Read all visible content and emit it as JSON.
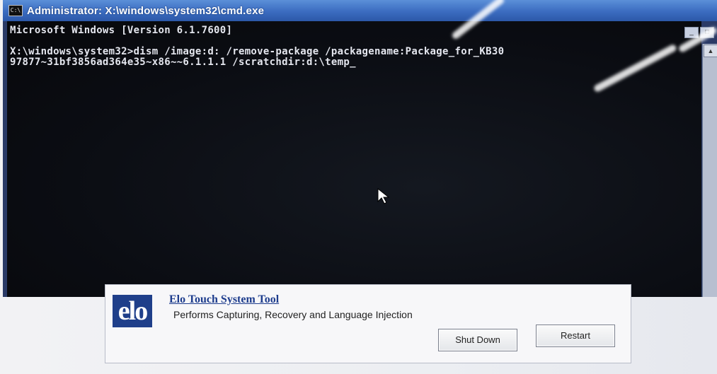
{
  "window": {
    "title": "Administrator: X:\\windows\\system32\\cmd.exe",
    "icon_label": "C:\\"
  },
  "console": {
    "lines": [
      "Microsoft Windows [Version 6.1.7600]",
      "",
      "X:\\windows\\system32>dism /image:d: /remove-package /packagename:Package_for_KB30",
      "97877~31bf3856ad364e35~x86~~6.1.1.1 /scratchdir:d:\\temp_"
    ]
  },
  "elo_tool": {
    "logo_text": "elo",
    "title": "Elo Touch System Tool",
    "description": "Performs Capturing, Recovery and Language Injection",
    "shutdown_label": "Shut Down",
    "restart_label": "Restart"
  },
  "colors": {
    "titlebar": "#3b6cc0",
    "console_bg": "#0b0d13",
    "console_text": "#e4e6ee",
    "elo_blue": "#1d3c8d"
  }
}
